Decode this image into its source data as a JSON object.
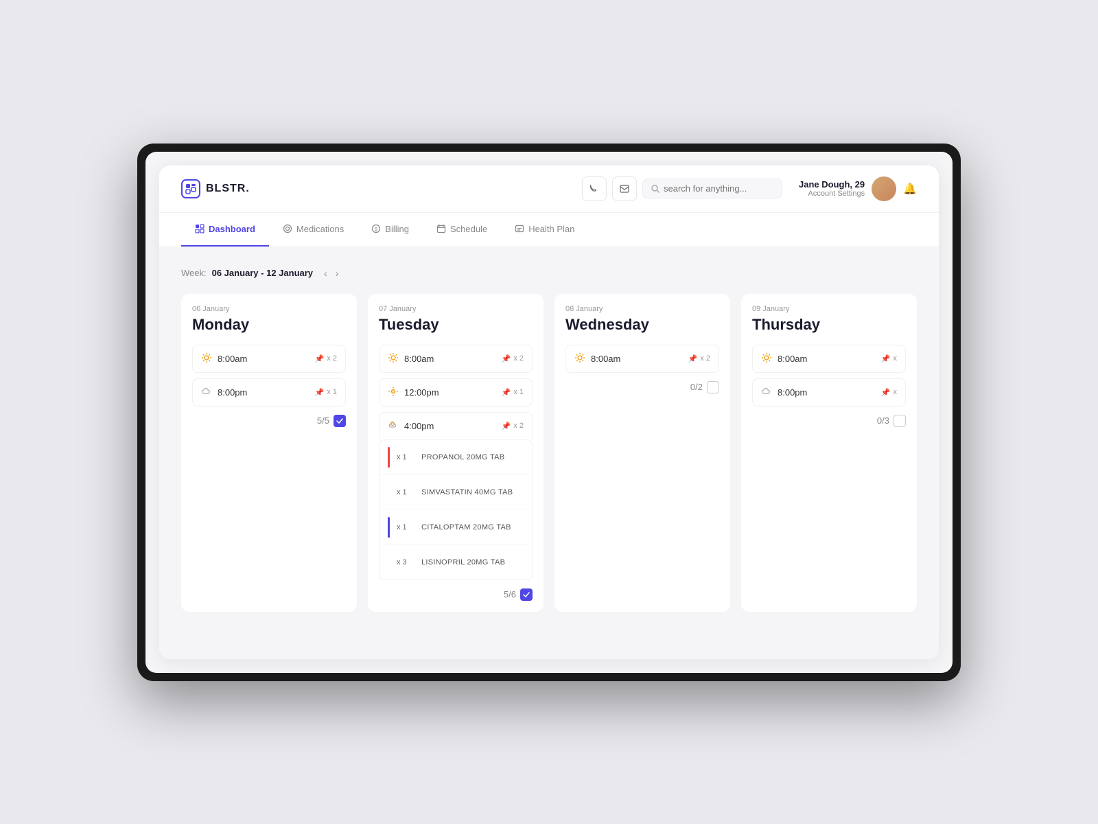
{
  "app": {
    "logo_text": "BLSTR.",
    "logo_icon": "⬡"
  },
  "header": {
    "phone_icon": "📞",
    "mail_icon": "✉",
    "search_placeholder": "search for anything...",
    "user_name": "Jane Dough, 29",
    "account_settings": "Account Settings",
    "bell_icon": "🔔"
  },
  "nav": {
    "items": [
      {
        "id": "dashboard",
        "label": "Dashboard",
        "icon": "⊞",
        "active": true
      },
      {
        "id": "medications",
        "label": "Medications",
        "icon": "◎",
        "active": false
      },
      {
        "id": "billing",
        "label": "Billing",
        "icon": "◉",
        "active": false
      },
      {
        "id": "schedule",
        "label": "Schedule",
        "icon": "▦",
        "active": false
      },
      {
        "id": "health-plan",
        "label": "Health Plan",
        "icon": "⊡",
        "active": false
      }
    ]
  },
  "week": {
    "label": "Week:",
    "range": "06 January - 12 January"
  },
  "days": [
    {
      "id": "monday",
      "date": "06 January",
      "name": "Monday",
      "slots": [
        {
          "time": "8:00am",
          "icon": "☀",
          "count": "x 2"
        },
        {
          "time": "8:00pm",
          "icon": "☁",
          "count": "x 1"
        }
      ],
      "score": "5/5",
      "checked": true
    },
    {
      "id": "tuesday",
      "date": "07 January",
      "name": "Tuesday",
      "slots": [
        {
          "time": "8:00am",
          "icon": "☀",
          "count": "x 2"
        },
        {
          "time": "12:00pm",
          "icon": "☀",
          "count": "x 1"
        },
        {
          "time": "4:00pm",
          "icon": "⛅",
          "count": "x 2",
          "expanded": true
        }
      ],
      "medications": [
        {
          "indicator": "red",
          "qty": "x 1",
          "name": "PROPANOL 20MG TAB"
        },
        {
          "indicator": "gray",
          "qty": "x 1",
          "name": "SIMVASTATIN 40MG TAB"
        },
        {
          "indicator": "blue",
          "qty": "x 1",
          "name": "CITALOPTAM 20MG TAB"
        },
        {
          "indicator": "gray",
          "qty": "x 3",
          "name": "LISINOPRIL 20MG TAB"
        }
      ],
      "score": "5/6",
      "checked": true
    },
    {
      "id": "wednesday",
      "date": "08 January",
      "name": "Wednesday",
      "slots": [
        {
          "time": "8:00am",
          "icon": "☀",
          "count": "x 2"
        }
      ],
      "score": "0/2",
      "checked": false
    },
    {
      "id": "thursday",
      "date": "09 January",
      "name": "Thursday",
      "slots": [
        {
          "time": "8:00am",
          "icon": "☀",
          "count": "x"
        },
        {
          "time": "8:00pm",
          "icon": "☁",
          "count": "x"
        }
      ],
      "score": "0/3",
      "checked": false
    }
  ]
}
